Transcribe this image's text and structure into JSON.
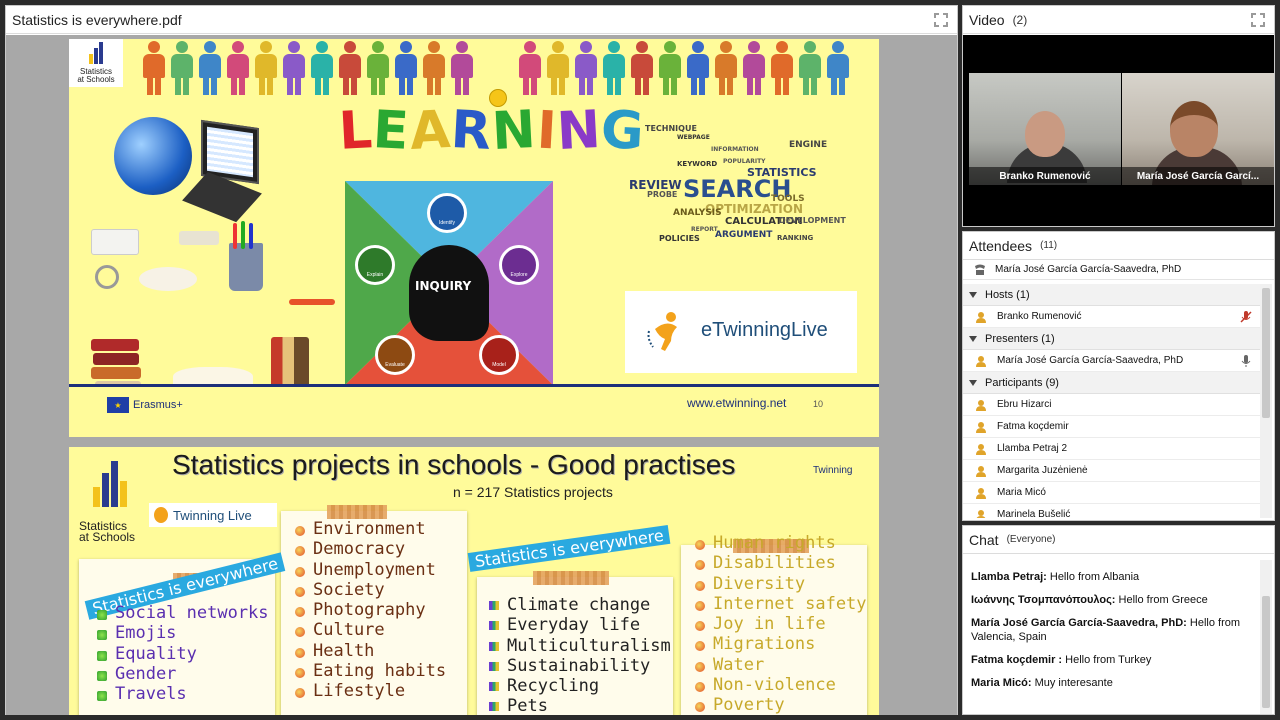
{
  "pdf_pod": {
    "title": "Statistics is everywhere.pdf",
    "slide1": {
      "logo_text_line1": "Statistics",
      "logo_text_line2": "at Schools",
      "learning_word": [
        "L",
        "E",
        "A",
        "R",
        "N",
        "I",
        "N",
        "G"
      ],
      "inquiry_label": "INQUIRY",
      "inquiry_steps": [
        "Identify",
        "Explore",
        "Model",
        "Evaluate",
        "Explain"
      ],
      "word_cloud": [
        "TECHNIQUE",
        "WEBPAGE",
        "KEYWORD",
        "STATISTICS",
        "ENGINE",
        "REVIEW",
        "PROBE",
        "SEARCH",
        "TOOLS",
        "OPTIMIZATION",
        "CALCULATION",
        "ANALYSIS",
        "POLICIES",
        "ARGUMENT",
        "DEVELOPMENT",
        "RANKING",
        "INFORMATION",
        "POPULARITY",
        "REPORT"
      ],
      "etwinning_logo": "eTwinningLive",
      "erasmus_label": "Erasmus+",
      "url": "www.etwinning.net",
      "page_number": "10"
    },
    "slide2": {
      "title": "Statistics projects in schools - Good practises",
      "subtitle": "n = 217 Statistics projects",
      "logo_text_line1": "Statistics",
      "logo_text_line2": "at Schools",
      "etwinning_live": "Twinning Live",
      "twinning_logo": "Twinning",
      "banner": "Statistics is everywhere",
      "list1": [
        "Social networks",
        "Emojis",
        "Equality",
        "Gender",
        "Travels"
      ],
      "list2": [
        "Environment",
        "Democracy",
        "Unemployment",
        "Society",
        "Photography",
        "Culture",
        "Health",
        "Eating habits",
        "Lifestyle"
      ],
      "list3": [
        "Climate change",
        "Everyday life",
        "Multiculturalism",
        "Sustainability",
        "Recycling",
        "Pets"
      ],
      "list4": [
        "Human rights",
        "Disabilities",
        "Diversity",
        "Internet safety",
        "Joy in life",
        "Migrations",
        "Water",
        "Non-violence",
        "Poverty"
      ]
    }
  },
  "video_pod": {
    "title": "Video",
    "count": "(2)",
    "participants": [
      "Branko Rumenović",
      "María José García Garcí..."
    ]
  },
  "attendees_pod": {
    "title": "Attendees",
    "count": "(11)",
    "current_user": "María José García García-Saavedra, PhD",
    "groups": [
      {
        "label": "Hosts (1)",
        "members": [
          "Branko Rumenović"
        ]
      },
      {
        "label": "Presenters (1)",
        "members": [
          "María José García García-Saavedra, PhD"
        ]
      },
      {
        "label": "Participants (9)",
        "members": [
          "Ebru Hizarci",
          "Fatma  koçdemir",
          "Llamba Petraj 2",
          "Margarita Juzėnienė",
          "Maria Micó",
          "Marinela Bušelić"
        ]
      }
    ]
  },
  "chat_pod": {
    "title": "Chat",
    "scope": "(Everyone)",
    "messages": [
      {
        "sender": "Llamba Petraj:",
        "text": " Hello from Albania"
      },
      {
        "sender": "Ιωάννης Τσομπανόπουλος:",
        "text": " Hello from Greece"
      },
      {
        "sender": "María José García García-Saavedra, PhD:",
        "text": " Hello from Valencia, Spain"
      },
      {
        "sender": "Fatma  koçdemir :",
        "text": " Hello from Turkey"
      },
      {
        "sender": "Maria Micó:",
        "text": " Muy interesante"
      }
    ]
  },
  "colors": {
    "slide_yellow": "#fffb9a",
    "etwinning_blue": "#1f4e79",
    "banner_blue": "#2aa9e0",
    "pod_border": "#c9c9c9"
  }
}
